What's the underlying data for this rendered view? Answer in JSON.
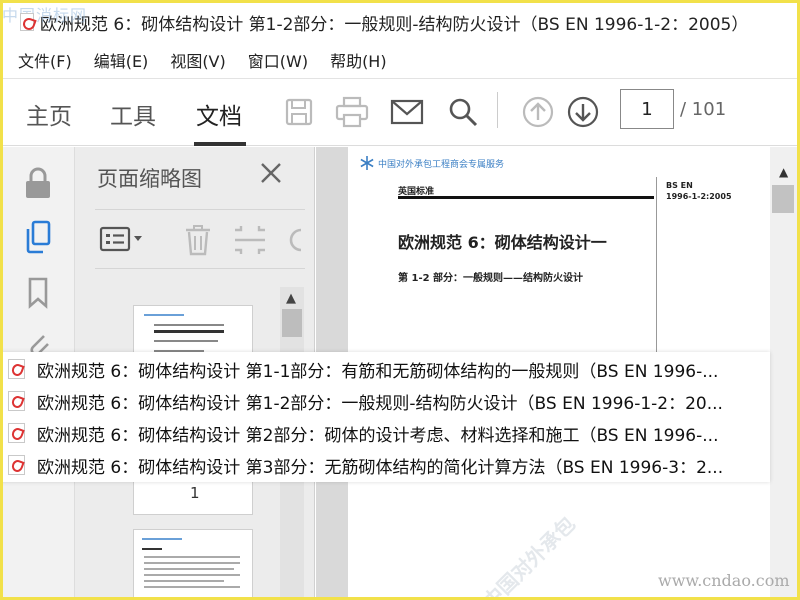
{
  "watermark_site": "中国消标网",
  "window": {
    "title": "欧洲规范 6：砌体结构设计 第1-2部分：一般规则-结构防火设计（BS EN 1996-1-2：2005）"
  },
  "menu": [
    "文件(F)",
    "编辑(E)",
    "视图(V)",
    "窗口(W)",
    "帮助(H)"
  ],
  "toolbar": {
    "tabs": [
      "主页",
      "工具",
      "文档"
    ],
    "active_tab": "文档",
    "page_current": "1",
    "page_total": "/ 101"
  },
  "thumb_panel": {
    "title": "页面缩略图",
    "page_label": "1"
  },
  "doc": {
    "brand": "中国对外承包工程商会专属服务",
    "header_left": "英国标准",
    "header_right": "BS EN\n1996-1-2:2005",
    "title": "欧洲规范 6：砌体结构设计一",
    "subtitle": "第 1-2 部分：一般规则——结构防火设计"
  },
  "popup": {
    "items": [
      "欧洲规范 6：砌体结构设计 第1-1部分：有筋和无筋砌体结构的一般规则（BS EN 1996-...",
      "欧洲规范 6：砌体结构设计 第1-2部分：一般规则-结构防火设计（BS EN 1996-1-2：20...",
      "欧洲规范 6：砌体结构设计 第2部分：砌体的设计考虑、材料选择和施工（BS EN 1996-...",
      "欧洲规范 6：砌体结构设计 第3部分：无筋砌体结构的简化计算方法（BS EN 1996-3：2..."
    ]
  },
  "footer_site": "www.cndao.com",
  "colors": {
    "frame": "#f2e14a",
    "brand_blue": "#3b7fc4",
    "pdf_red": "#dd3333"
  }
}
